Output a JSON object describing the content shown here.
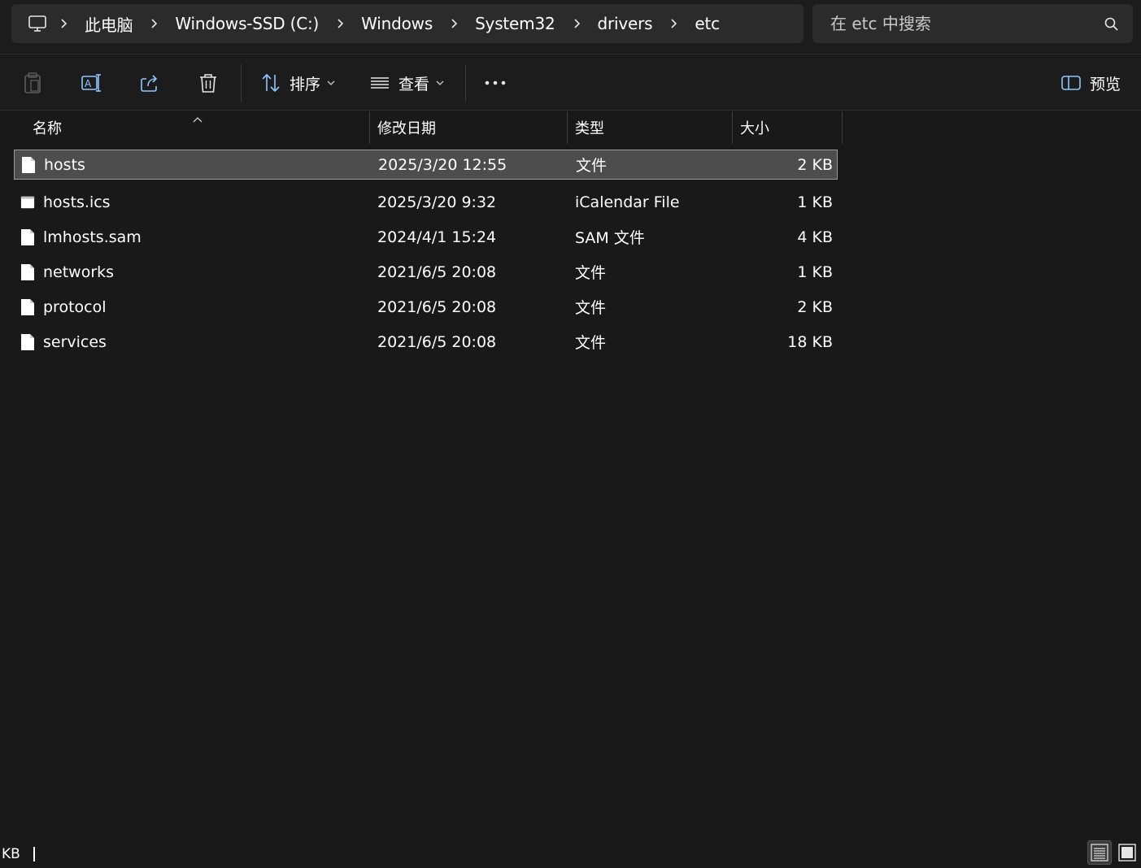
{
  "breadcrumb": {
    "items": [
      "此电脑",
      "Windows-SSD (C:)",
      "Windows",
      "System32",
      "drivers",
      "etc"
    ]
  },
  "search": {
    "placeholder": "在 etc 中搜索"
  },
  "toolbar": {
    "sort_label": "排序",
    "view_label": "查看",
    "preview_label": "预览"
  },
  "columns": {
    "name": "名称",
    "date": "修改日期",
    "type": "类型",
    "size": "大小"
  },
  "files": [
    {
      "name": "hosts",
      "date": "2025/3/20 12:55",
      "type": "文件",
      "size": "2 KB",
      "selected": true,
      "icon": "file-icon"
    },
    {
      "name": "hosts.ics",
      "date": "2025/3/20 9:32",
      "type": "iCalendar File",
      "size": "1 KB",
      "selected": false,
      "icon": "calendar-file-icon"
    },
    {
      "name": "lmhosts.sam",
      "date": "2024/4/1 15:24",
      "type": "SAM 文件",
      "size": "4 KB",
      "selected": false,
      "icon": "file-icon"
    },
    {
      "name": "networks",
      "date": "2021/6/5 20:08",
      "type": "文件",
      "size": "1 KB",
      "selected": false,
      "icon": "file-icon"
    },
    {
      "name": "protocol",
      "date": "2021/6/5 20:08",
      "type": "文件",
      "size": "2 KB",
      "selected": false,
      "icon": "file-icon"
    },
    {
      "name": "services",
      "date": "2021/6/5 20:08",
      "type": "文件",
      "size": "18 KB",
      "selected": false,
      "icon": "file-icon"
    }
  ],
  "status": {
    "text": "KB"
  },
  "colors": {
    "background": "#191919",
    "bar": "#2b2b2b",
    "selected_row": "#4d4d4d",
    "accent_icon": "#6cb6ff"
  }
}
